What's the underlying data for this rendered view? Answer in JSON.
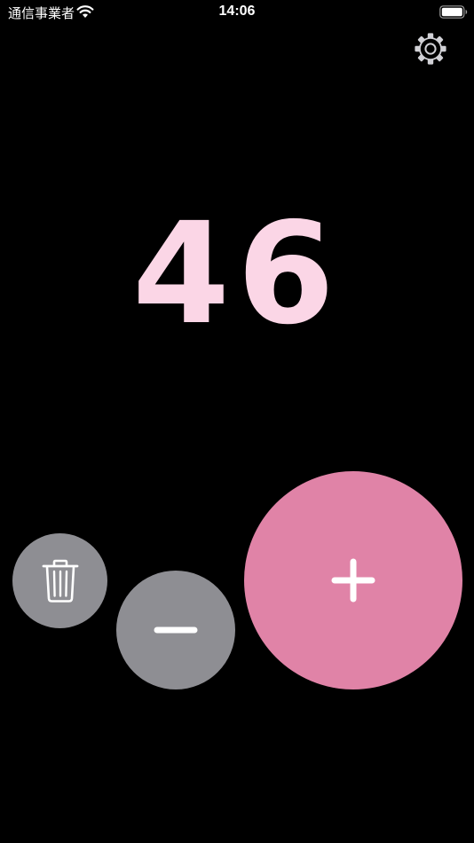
{
  "status_bar": {
    "carrier": "通信事業者",
    "time": "14:06",
    "wifi_icon": "wifi-icon",
    "battery_icon": "battery-full-icon"
  },
  "settings": {
    "icon": "gear-icon"
  },
  "counter": {
    "value": "46",
    "color": "#fbd6e6"
  },
  "buttons": {
    "reset": {
      "icon": "trash-icon",
      "color": "#8e8e93"
    },
    "decrement": {
      "icon": "minus-icon",
      "color": "#8e8e93"
    },
    "increment": {
      "icon": "plus-icon",
      "color": "#e083a7"
    }
  }
}
